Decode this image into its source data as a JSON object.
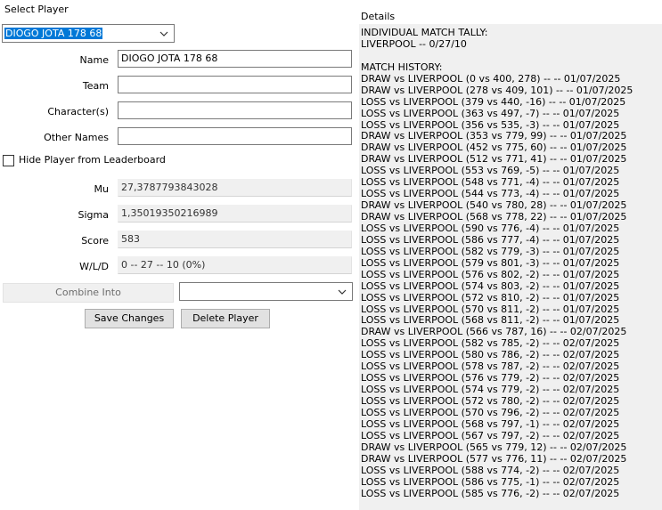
{
  "select_player": {
    "label": "Select Player",
    "selected": "DIOGO JOTA 178 68"
  },
  "form": {
    "name_label": "Name",
    "name_value": "DIOGO JOTA 178 68",
    "team_label": "Team",
    "team_value": "",
    "characters_label": "Character(s)",
    "characters_value": "",
    "other_names_label": "Other Names",
    "other_names_value": "",
    "hide_label": "Hide Player from Leaderboard",
    "hide_checked": false,
    "mu_label": "Mu",
    "mu_value": "27,3787793843028",
    "sigma_label": "Sigma",
    "sigma_value": "1,35019350216989",
    "score_label": "Score",
    "score_value": "583",
    "wld_label": "W/L/D",
    "wld_value": "0 -- 27 -- 10 (0%)",
    "combine_label": "Combine Into",
    "combine_value": ""
  },
  "buttons": {
    "save": "Save Changes",
    "delete": "Delete Player"
  },
  "details": {
    "title": "Details",
    "lines": [
      "INDIVIDUAL MATCH TALLY:",
      "LIVERPOOL -- 0/27/10",
      "",
      "MATCH HISTORY:",
      "DRAW vs LIVERPOOL (0 vs 400, 278) --  -- 01/07/2025",
      "DRAW vs LIVERPOOL (278 vs 409, 101) --  -- 01/07/2025",
      "LOSS vs LIVERPOOL (379 vs 440, -16) --  -- 01/07/2025",
      "LOSS vs LIVERPOOL (363 vs 497, -7) --  -- 01/07/2025",
      "LOSS vs LIVERPOOL (356 vs 535, -3) --  -- 01/07/2025",
      "DRAW vs LIVERPOOL (353 vs 779, 99) --  -- 01/07/2025",
      "DRAW vs LIVERPOOL (452 vs 775, 60) --  -- 01/07/2025",
      "DRAW vs LIVERPOOL (512 vs 771, 41) --  -- 01/07/2025",
      "LOSS vs LIVERPOOL (553 vs 769, -5) --  -- 01/07/2025",
      "LOSS vs LIVERPOOL (548 vs 771, -4) --  -- 01/07/2025",
      "LOSS vs LIVERPOOL (544 vs 773, -4) --  -- 01/07/2025",
      "DRAW vs LIVERPOOL (540 vs 780, 28) --  -- 01/07/2025",
      "DRAW vs LIVERPOOL (568 vs 778, 22) --  -- 01/07/2025",
      "LOSS vs LIVERPOOL (590 vs 776, -4) --  -- 01/07/2025",
      "LOSS vs LIVERPOOL (586 vs 777, -4) --  -- 01/07/2025",
      "LOSS vs LIVERPOOL (582 vs 779, -3) --  -- 01/07/2025",
      "LOSS vs LIVERPOOL (579 vs 801, -3) --  -- 01/07/2025",
      "LOSS vs LIVERPOOL (576 vs 802, -2) --  -- 01/07/2025",
      "LOSS vs LIVERPOOL (574 vs 803, -2) --  -- 01/07/2025",
      "LOSS vs LIVERPOOL (572 vs 810, -2) --  -- 01/07/2025",
      "LOSS vs LIVERPOOL (570 vs 811, -2) --  -- 01/07/2025",
      "LOSS vs LIVERPOOL (568 vs 811, -2) --  -- 01/07/2025",
      "DRAW vs LIVERPOOL (566 vs 787, 16) --  -- 02/07/2025",
      "LOSS vs LIVERPOOL (582 vs 785, -2) --  -- 02/07/2025",
      "LOSS vs LIVERPOOL (580 vs 786, -2) --  -- 02/07/2025",
      "LOSS vs LIVERPOOL (578 vs 787, -2) --  -- 02/07/2025",
      "LOSS vs LIVERPOOL (576 vs 779, -2) --  -- 02/07/2025",
      "LOSS vs LIVERPOOL (574 vs 779, -2) --  -- 02/07/2025",
      "LOSS vs LIVERPOOL (572 vs 780, -2) --  -- 02/07/2025",
      "LOSS vs LIVERPOOL (570 vs 796, -2) --  -- 02/07/2025",
      "LOSS vs LIVERPOOL (568 vs 797, -1) --  -- 02/07/2025",
      "LOSS vs LIVERPOOL (567 vs 797, -2) --  -- 02/07/2025",
      "DRAW vs LIVERPOOL (565 vs 779, 12) --  -- 02/07/2025",
      "DRAW vs LIVERPOOL (577 vs 776, 11) --  -- 02/07/2025",
      "LOSS vs LIVERPOOL (588 vs 774, -2) --  -- 02/07/2025",
      "LOSS vs LIVERPOOL (586 vs 775, -1) --  -- 02/07/2025",
      "LOSS vs LIVERPOOL (585 vs 776, -2) --  -- 02/07/2025"
    ]
  },
  "icons": {
    "dropdown": "chevron-down-icon"
  },
  "colors": {
    "selection": "#0078d7",
    "window_bg": "#f0f0f0",
    "button_bg": "#e1e1e1"
  }
}
